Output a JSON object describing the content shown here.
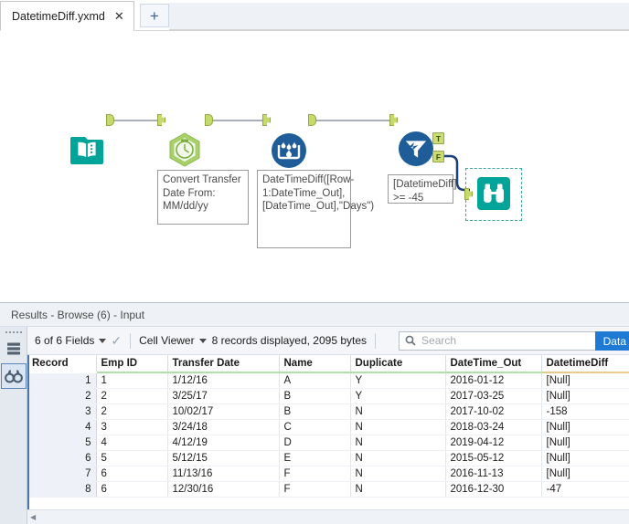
{
  "window": {
    "tab_label": "DatetimeDiff.yxmd",
    "close_label": "✕",
    "new_tab_label": "+"
  },
  "canvas": {
    "tools": [
      {
        "name": "input-data",
        "icon": "book-icon",
        "label": ""
      },
      {
        "name": "datetime",
        "icon": "clock-icon",
        "label": ""
      },
      {
        "name": "multi-row-formula",
        "icon": "water-droplet-icon",
        "label": ""
      },
      {
        "name": "filter",
        "icon": "funnel-icon",
        "label": ""
      },
      {
        "name": "browse",
        "icon": "binoculars-icon",
        "label": ""
      }
    ],
    "annotations": {
      "datetime": "Convert Transfer Date From: MM/dd/yy",
      "multi_row_formula": "DateTimeDiff([Row-1:DateTime_Out], [DateTime_Out],\"Days\")",
      "filter": "[DatetimeDiff] >= -45"
    },
    "ports": {
      "true": "T",
      "false": "F"
    }
  },
  "results": {
    "title": "Results - Browse (6) - Input",
    "fields_selector": "6 of 6 Fields",
    "viewer_selector": "Cell Viewer",
    "record_status": "8 records displayed, 2095 bytes",
    "search_placeholder": "Search",
    "data_button": "Data",
    "rail": {
      "table_icon": "table-icon",
      "browse_icon": "binoculars-icon"
    },
    "columns": [
      "Record",
      "Emp ID",
      "Transfer Date",
      "Name",
      "Duplicate",
      "DateTime_Out",
      "DatetimeDiff"
    ],
    "column_types": [
      "record",
      "green",
      "green",
      "green",
      "green",
      "green",
      "tan"
    ],
    "rows": [
      {
        "record": "1",
        "emp_id": "1",
        "transfer_date": "1/12/16",
        "name": "A",
        "duplicate": "Y",
        "datetime_out": "2016-01-12",
        "datetimediff": "[Null]",
        "diff_null": true
      },
      {
        "record": "2",
        "emp_id": "2",
        "transfer_date": "3/25/17",
        "name": "B",
        "duplicate": "Y",
        "datetime_out": "2017-03-25",
        "datetimediff": "[Null]",
        "diff_null": true
      },
      {
        "record": "3",
        "emp_id": "2",
        "transfer_date": "10/02/17",
        "name": "B",
        "duplicate": "N",
        "datetime_out": "2017-10-02",
        "datetimediff": "-158",
        "diff_null": false
      },
      {
        "record": "4",
        "emp_id": "3",
        "transfer_date": "3/24/18",
        "name": "C",
        "duplicate": "N",
        "datetime_out": "2018-03-24",
        "datetimediff": "[Null]",
        "diff_null": true
      },
      {
        "record": "5",
        "emp_id": "4",
        "transfer_date": "4/12/19",
        "name": "D",
        "duplicate": "N",
        "datetime_out": "2019-04-12",
        "datetimediff": "[Null]",
        "diff_null": true
      },
      {
        "record": "6",
        "emp_id": "5",
        "transfer_date": "5/12/15",
        "name": "E",
        "duplicate": "N",
        "datetime_out": "2015-05-12",
        "datetimediff": "[Null]",
        "diff_null": true
      },
      {
        "record": "7",
        "emp_id": "6",
        "transfer_date": "11/13/16",
        "name": "F",
        "duplicate": "N",
        "datetime_out": "2016-11-13",
        "datetimediff": "[Null]",
        "diff_null": true
      },
      {
        "record": "8",
        "emp_id": "6",
        "transfer_date": "12/30/16",
        "name": "F",
        "duplicate": "N",
        "datetime_out": "2016-12-30",
        "datetimediff": "-47",
        "diff_null": false
      }
    ]
  },
  "colors": {
    "teal": "#00a499",
    "green": "#8cc63f",
    "blue": "#1f5d99",
    "accent_blue": "#1f7ad4",
    "wire": "#a9b0b3"
  }
}
